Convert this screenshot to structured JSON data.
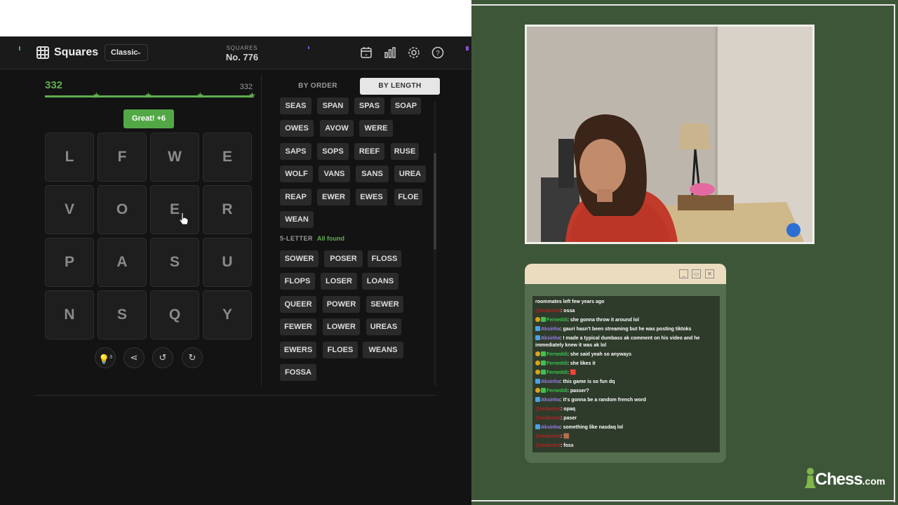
{
  "header": {
    "app_name": "Squares",
    "mode": "Classic",
    "puzzle_label": "SQUARES",
    "puzzle_number": "No. 776"
  },
  "score": {
    "current": "332",
    "target": "332",
    "progress_fraction": 1.0,
    "toast": "Great! +6"
  },
  "grid": [
    "L",
    "F",
    "W",
    "E",
    "V",
    "O",
    "E",
    "R",
    "P",
    "A",
    "S",
    "U",
    "N",
    "S",
    "Q",
    "Y"
  ],
  "tools": {
    "hint_count": "3"
  },
  "tabs": {
    "by_order": "BY ORDER",
    "by_length": "BY LENGTH",
    "active": "by_length"
  },
  "words_4": [
    "SEAS",
    "SPAN",
    "SPAS",
    "SOAP",
    "OWES",
    "AVOW",
    "WERE",
    "SAPS",
    "SOPS",
    "REEF",
    "RUSE",
    "WOLF",
    "VANS",
    "SANS",
    "UREA",
    "REAP",
    "EWER",
    "EWES",
    "FLOE",
    "WEAN"
  ],
  "section_5": {
    "label": "5-LETTER",
    "status": "All found"
  },
  "words_5": [
    "SOWER",
    "POSER",
    "FLOSS",
    "FLOPS",
    "LOSER",
    "LOANS",
    "QUEER",
    "POWER",
    "SEWER",
    "FEWER",
    "LOWER",
    "UREAS",
    "EWERS",
    "FLOES",
    "WEANS",
    "FOSSA"
  ],
  "chat": {
    "messages": [
      {
        "user": "",
        "text": "roommates left few years ago",
        "color": "#ffffff",
        "badges": []
      },
      {
        "user": "@redacted",
        "text": "ossa",
        "color": "#b22222",
        "badges": []
      },
      {
        "user": "Ferneddi",
        "text": "she gonna throw it around lol",
        "color": "#3cc24f",
        "badges": [
          "gold",
          "green"
        ]
      },
      {
        "user": "Aksinha",
        "text": "gauri hasn't been streaming but he was posting tiktoks",
        "color": "#9b7fe6",
        "badges": [
          "sword"
        ]
      },
      {
        "user": "Aksinha",
        "text": "I made a typical dumbass ak comment on his video and he immediately knew it was ak lol",
        "color": "#9b7fe6",
        "badges": [
          "sword"
        ]
      },
      {
        "user": "Ferneddi",
        "text": "she said yeah so anyways",
        "color": "#3cc24f",
        "badges": [
          "gold",
          "green"
        ]
      },
      {
        "user": "Ferneddi",
        "text": "she likes it",
        "color": "#3cc24f",
        "badges": [
          "gold",
          "green"
        ]
      },
      {
        "user": "Ferneddi",
        "text": "🟥",
        "color": "#3cc24f",
        "badges": [
          "gold",
          "green"
        ]
      },
      {
        "user": "Aksinha",
        "text": "this game is so fun dq",
        "color": "#9b7fe6",
        "badges": [
          "sword"
        ]
      },
      {
        "user": "Ferneddi",
        "text": "passer?",
        "color": "#3cc24f",
        "badges": [
          "gold",
          "green"
        ]
      },
      {
        "user": "Aksinha",
        "text": "it's gonna be a random french word",
        "color": "#9b7fe6",
        "badges": [
          "sword"
        ]
      },
      {
        "user": "@redacted",
        "text": "opaq",
        "color": "#b22222",
        "badges": []
      },
      {
        "user": "@redacted",
        "text": "paser",
        "color": "#b22222",
        "badges": []
      },
      {
        "user": "Aksinha",
        "text": "something like nasdaq lol",
        "color": "#9b7fe6",
        "badges": [
          "sword"
        ]
      },
      {
        "user": "@redacted",
        "text": "🟫",
        "color": "#b22222",
        "badges": []
      },
      {
        "user": "@redacted",
        "text": "foss",
        "color": "#b22222",
        "badges": []
      }
    ]
  },
  "brand": {
    "name": "Chess",
    "suffix": ".com"
  },
  "colors": {
    "accent_green": "#5fae4e",
    "background": "#3d5638",
    "chat_titlebar": "#ecdcbf"
  }
}
